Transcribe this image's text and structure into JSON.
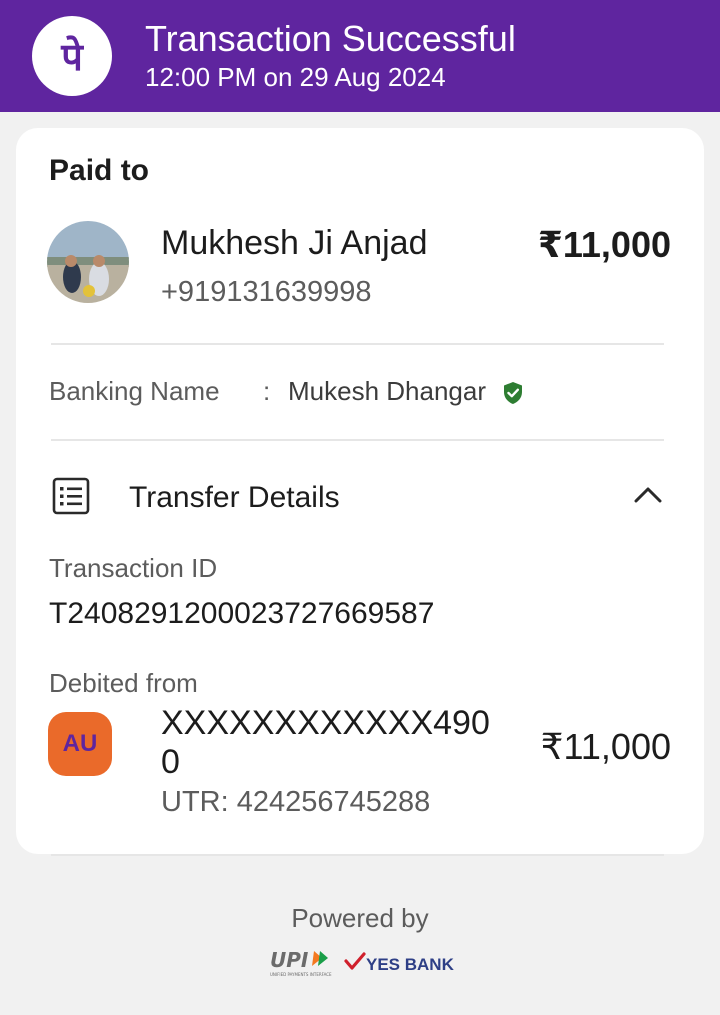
{
  "header": {
    "title": "Transaction Successful",
    "timestamp": "12:00 PM on 29 Aug 2024",
    "logo_glyph": "पे",
    "logo_icon": "phonepe-logo-icon",
    "bg_color": "#5f259f"
  },
  "paid_to": {
    "heading": "Paid to",
    "name": "Mukhesh Ji Anjad",
    "phone": "+919131639998",
    "amount": "₹11,000"
  },
  "banking": {
    "label": "Banking Name",
    "separator": ":",
    "name": "Mukesh Dhangar",
    "verified_icon": "verified-shield-icon",
    "verified_color": "#2e7d32"
  },
  "transfer_details": {
    "title": "Transfer Details",
    "transaction_id_label": "Transaction ID",
    "transaction_id": "T2408291200023727669587",
    "debited_from_label": "Debited from",
    "bank_logo_text": "AU",
    "account_number": "XXXXXXXXXXXX4900",
    "utr": "UTR: 424256745288",
    "amount": "₹11,000"
  },
  "footer": {
    "powered_by": "Powered by",
    "upi_text": "UPI",
    "upi_subtext": "UNIFIED PAYMENTS INTERFACE",
    "bank_partner": "YES BANK"
  }
}
